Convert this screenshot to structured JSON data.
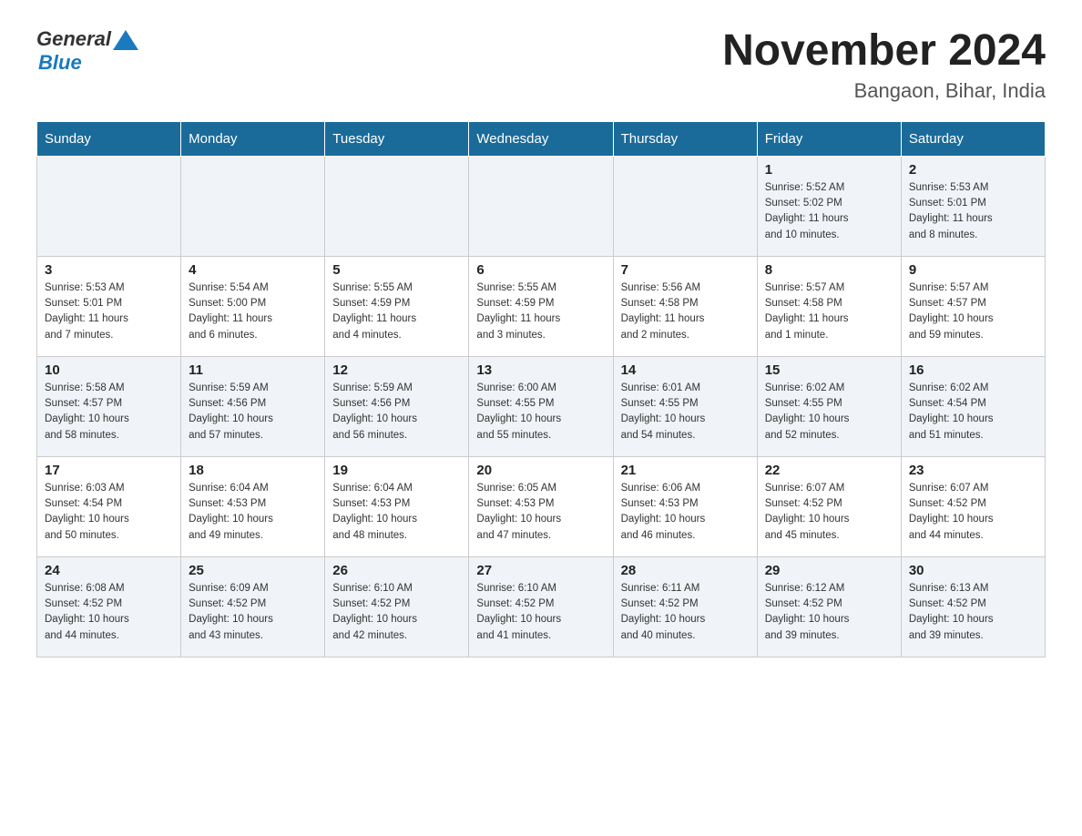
{
  "header": {
    "logo": {
      "general": "General",
      "blue": "Blue"
    },
    "title": "November 2024",
    "location": "Bangaon, Bihar, India"
  },
  "weekdays": [
    "Sunday",
    "Monday",
    "Tuesday",
    "Wednesday",
    "Thursday",
    "Friday",
    "Saturday"
  ],
  "weeks": [
    {
      "days": [
        {
          "num": "",
          "info": ""
        },
        {
          "num": "",
          "info": ""
        },
        {
          "num": "",
          "info": ""
        },
        {
          "num": "",
          "info": ""
        },
        {
          "num": "",
          "info": ""
        },
        {
          "num": "1",
          "info": "Sunrise: 5:52 AM\nSunset: 5:02 PM\nDaylight: 11 hours\nand 10 minutes."
        },
        {
          "num": "2",
          "info": "Sunrise: 5:53 AM\nSunset: 5:01 PM\nDaylight: 11 hours\nand 8 minutes."
        }
      ]
    },
    {
      "days": [
        {
          "num": "3",
          "info": "Sunrise: 5:53 AM\nSunset: 5:01 PM\nDaylight: 11 hours\nand 7 minutes."
        },
        {
          "num": "4",
          "info": "Sunrise: 5:54 AM\nSunset: 5:00 PM\nDaylight: 11 hours\nand 6 minutes."
        },
        {
          "num": "5",
          "info": "Sunrise: 5:55 AM\nSunset: 4:59 PM\nDaylight: 11 hours\nand 4 minutes."
        },
        {
          "num": "6",
          "info": "Sunrise: 5:55 AM\nSunset: 4:59 PM\nDaylight: 11 hours\nand 3 minutes."
        },
        {
          "num": "7",
          "info": "Sunrise: 5:56 AM\nSunset: 4:58 PM\nDaylight: 11 hours\nand 2 minutes."
        },
        {
          "num": "8",
          "info": "Sunrise: 5:57 AM\nSunset: 4:58 PM\nDaylight: 11 hours\nand 1 minute."
        },
        {
          "num": "9",
          "info": "Sunrise: 5:57 AM\nSunset: 4:57 PM\nDaylight: 10 hours\nand 59 minutes."
        }
      ]
    },
    {
      "days": [
        {
          "num": "10",
          "info": "Sunrise: 5:58 AM\nSunset: 4:57 PM\nDaylight: 10 hours\nand 58 minutes."
        },
        {
          "num": "11",
          "info": "Sunrise: 5:59 AM\nSunset: 4:56 PM\nDaylight: 10 hours\nand 57 minutes."
        },
        {
          "num": "12",
          "info": "Sunrise: 5:59 AM\nSunset: 4:56 PM\nDaylight: 10 hours\nand 56 minutes."
        },
        {
          "num": "13",
          "info": "Sunrise: 6:00 AM\nSunset: 4:55 PM\nDaylight: 10 hours\nand 55 minutes."
        },
        {
          "num": "14",
          "info": "Sunrise: 6:01 AM\nSunset: 4:55 PM\nDaylight: 10 hours\nand 54 minutes."
        },
        {
          "num": "15",
          "info": "Sunrise: 6:02 AM\nSunset: 4:55 PM\nDaylight: 10 hours\nand 52 minutes."
        },
        {
          "num": "16",
          "info": "Sunrise: 6:02 AM\nSunset: 4:54 PM\nDaylight: 10 hours\nand 51 minutes."
        }
      ]
    },
    {
      "days": [
        {
          "num": "17",
          "info": "Sunrise: 6:03 AM\nSunset: 4:54 PM\nDaylight: 10 hours\nand 50 minutes."
        },
        {
          "num": "18",
          "info": "Sunrise: 6:04 AM\nSunset: 4:53 PM\nDaylight: 10 hours\nand 49 minutes."
        },
        {
          "num": "19",
          "info": "Sunrise: 6:04 AM\nSunset: 4:53 PM\nDaylight: 10 hours\nand 48 minutes."
        },
        {
          "num": "20",
          "info": "Sunrise: 6:05 AM\nSunset: 4:53 PM\nDaylight: 10 hours\nand 47 minutes."
        },
        {
          "num": "21",
          "info": "Sunrise: 6:06 AM\nSunset: 4:53 PM\nDaylight: 10 hours\nand 46 minutes."
        },
        {
          "num": "22",
          "info": "Sunrise: 6:07 AM\nSunset: 4:52 PM\nDaylight: 10 hours\nand 45 minutes."
        },
        {
          "num": "23",
          "info": "Sunrise: 6:07 AM\nSunset: 4:52 PM\nDaylight: 10 hours\nand 44 minutes."
        }
      ]
    },
    {
      "days": [
        {
          "num": "24",
          "info": "Sunrise: 6:08 AM\nSunset: 4:52 PM\nDaylight: 10 hours\nand 44 minutes."
        },
        {
          "num": "25",
          "info": "Sunrise: 6:09 AM\nSunset: 4:52 PM\nDaylight: 10 hours\nand 43 minutes."
        },
        {
          "num": "26",
          "info": "Sunrise: 6:10 AM\nSunset: 4:52 PM\nDaylight: 10 hours\nand 42 minutes."
        },
        {
          "num": "27",
          "info": "Sunrise: 6:10 AM\nSunset: 4:52 PM\nDaylight: 10 hours\nand 41 minutes."
        },
        {
          "num": "28",
          "info": "Sunrise: 6:11 AM\nSunset: 4:52 PM\nDaylight: 10 hours\nand 40 minutes."
        },
        {
          "num": "29",
          "info": "Sunrise: 6:12 AM\nSunset: 4:52 PM\nDaylight: 10 hours\nand 39 minutes."
        },
        {
          "num": "30",
          "info": "Sunrise: 6:13 AM\nSunset: 4:52 PM\nDaylight: 10 hours\nand 39 minutes."
        }
      ]
    }
  ]
}
